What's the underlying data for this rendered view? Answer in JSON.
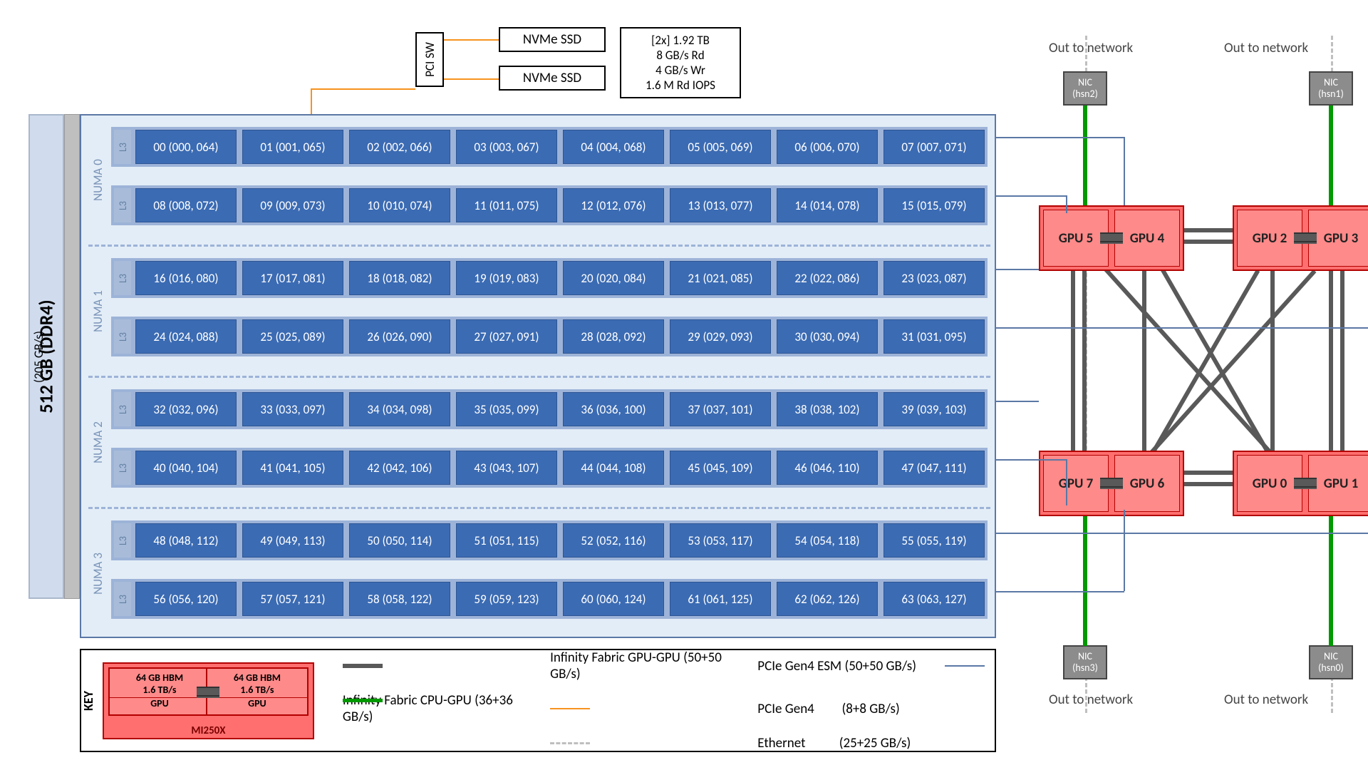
{
  "labels": {
    "pci_sw": "PCI SW",
    "ssd": "NVMe SSD",
    "ssd_specs": [
      "[2x] 1.92 TB",
      "8 GB/s Rd",
      "4 GB/s Wr",
      "1.6 M Rd IOPS"
    ],
    "memory_title": "512 GB  (DDR4)",
    "memory_sub": "(205 GB/s)",
    "numa": [
      "NUMA 0",
      "NUMA 1",
      "NUMA 2",
      "NUMA 3"
    ],
    "l3": "L3",
    "nic": [
      "NIC",
      "NIC",
      "NIC",
      "NIC"
    ],
    "nic_sub": [
      "(hsn2)",
      "(hsn1)",
      "(hsn3)",
      "(hsn0)"
    ],
    "out_to_network": "Out to network",
    "key": "KEY",
    "mi250x": "MI250X",
    "key_hbm": "64 GB HBM",
    "key_hbm_bw": "1.6 TB/s",
    "key_gpu": "GPU"
  },
  "cores": [
    [
      "00 (000, 064)",
      "01 (001, 065)",
      "02 (002, 066)",
      "03 (003, 067)",
      "04 (004, 068)",
      "05 (005, 069)",
      "06 (006, 070)",
      "07 (007, 071)"
    ],
    [
      "08 (008, 072)",
      "09 (009, 073)",
      "10 (010, 074)",
      "11 (011, 075)",
      "12 (012, 076)",
      "13 (013, 077)",
      "14 (014, 078)",
      "15 (015, 079)"
    ],
    [
      "16 (016, 080)",
      "17 (017, 081)",
      "18 (018, 082)",
      "19 (019, 083)",
      "20 (020, 084)",
      "21 (021, 085)",
      "22 (022, 086)",
      "23 (023, 087)"
    ],
    [
      "24 (024, 088)",
      "25 (025, 089)",
      "26 (026, 090)",
      "27 (027, 091)",
      "28 (028, 092)",
      "29 (029, 093)",
      "30 (030, 094)",
      "31 (031, 095)"
    ],
    [
      "32 (032, 096)",
      "33 (033, 097)",
      "34 (034, 098)",
      "35 (035, 099)",
      "36 (036, 100)",
      "37 (037, 101)",
      "38 (038, 102)",
      "39 (039, 103)"
    ],
    [
      "40 (040, 104)",
      "41 (041, 105)",
      "42 (042, 106)",
      "43 (043, 107)",
      "44 (044, 108)",
      "45 (045, 109)",
      "46 (046, 110)",
      "47 (047, 111)"
    ],
    [
      "48 (048, 112)",
      "49 (049, 113)",
      "50 (050, 114)",
      "51 (051, 115)",
      "52 (052, 116)",
      "53 (053, 117)",
      "54 (054, 118)",
      "55 (055, 119)"
    ],
    [
      "56 (056, 120)",
      "57 (057, 121)",
      "58 (058, 122)",
      "59 (059, 123)",
      "60 (060, 124)",
      "61 (061, 125)",
      "62 (062, 126)",
      "63 (063, 127)"
    ]
  ],
  "gpus": {
    "top_left": [
      "GPU 5",
      "GPU 4"
    ],
    "top_right": [
      "GPU 2",
      "GPU 3"
    ],
    "bot_left": [
      "GPU 7",
      "GPU 6"
    ],
    "bot_right": [
      "GPU 0",
      "GPU 1"
    ]
  },
  "legend": {
    "if_gpu": "Infinity Fabric GPU-GPU  (50+50 GB/s)",
    "if_cpu": "Infinity Fabric CPU-GPU  (36+36 GB/s)",
    "esm": "PCIe Gen4 ESM  (50+50 GB/s)",
    "pcie": "PCIe Gen4",
    "pcie_bw": "(8+8 GB/s)",
    "eth": "Ethernet",
    "eth_bw": "(25+25 GB/s)"
  }
}
